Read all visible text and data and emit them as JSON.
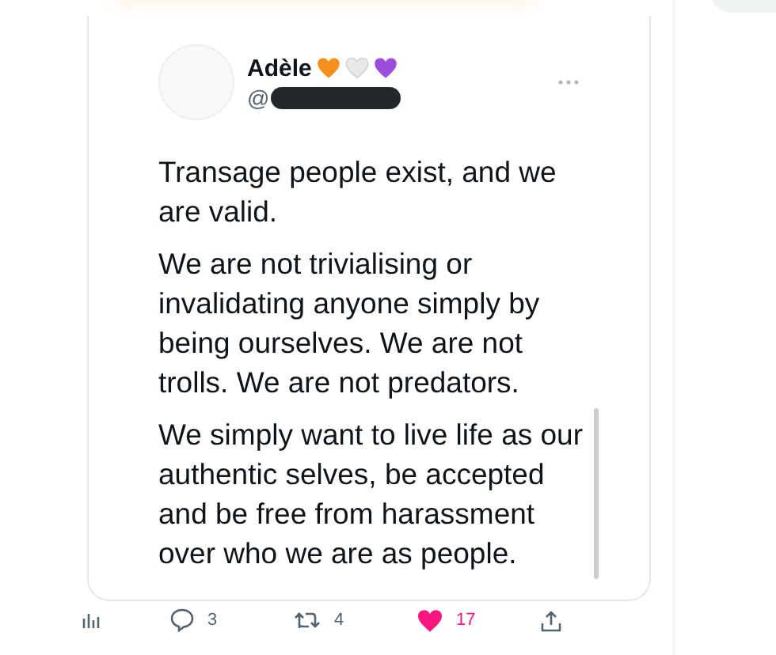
{
  "tweet": {
    "author": {
      "name": "Adèle",
      "hearts": [
        {
          "color": "#f5901e"
        },
        {
          "color": "#e8e8e8"
        },
        {
          "color": "#9b4ddb"
        }
      ],
      "handle_prefix": "@",
      "handle_redacted": true
    },
    "paragraphs": [
      "Transage people exist, and we are valid.",
      "We are not trivialising or invalidating anyone simply by being ourselves. We are not trolls. We are not predators.",
      "We simply want to live life as our authentic selves, be accepted and be free from harassment over who we are as people."
    ]
  },
  "actions": [
    {
      "kind": "stats"
    },
    {
      "kind": "reply",
      "count": "3"
    },
    {
      "kind": "retweet",
      "count": "4"
    },
    {
      "kind": "like",
      "count": "17",
      "liked": true
    },
    {
      "kind": "share"
    }
  ]
}
